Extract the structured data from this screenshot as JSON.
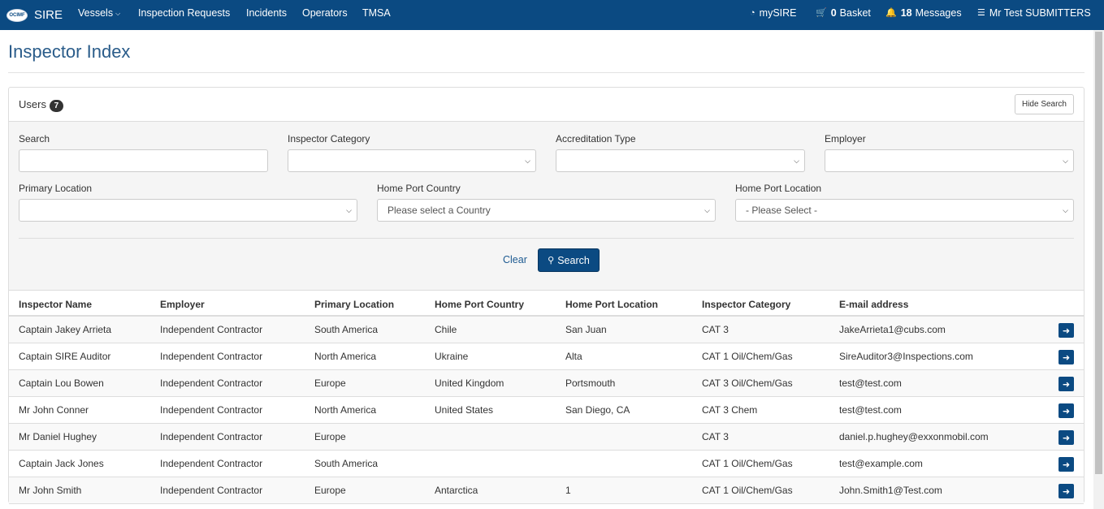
{
  "nav": {
    "logo_text": "OCIMF",
    "brand": "SIRE",
    "items": [
      {
        "label": "Vessels",
        "dropdown": true
      },
      {
        "label": "Inspection Requests"
      },
      {
        "label": "Incidents"
      },
      {
        "label": "Operators"
      },
      {
        "label": "TMSA"
      }
    ],
    "right": {
      "mysire": "mySIRE",
      "basket_count": "0",
      "basket_label": "Basket",
      "messages_count": "18",
      "messages_label": "Messages",
      "user": "Mr Test SUBMITTERS"
    },
    "color": "#0b4a82"
  },
  "page": {
    "title": "Inspector Index"
  },
  "panel": {
    "title": "Users",
    "count": "7",
    "hide_search_label": "Hide Search"
  },
  "filters": {
    "search": {
      "label": "Search",
      "value": ""
    },
    "inspector_category": {
      "label": "Inspector Category",
      "value": ""
    },
    "accreditation_type": {
      "label": "Accreditation Type",
      "value": ""
    },
    "employer": {
      "label": "Employer",
      "value": ""
    },
    "primary_location": {
      "label": "Primary Location",
      "value": ""
    },
    "home_port_country": {
      "label": "Home Port Country",
      "value": "Please select a Country"
    },
    "home_port_location": {
      "label": "Home Port Location",
      "value": "- Please Select -"
    },
    "clear_label": "Clear",
    "search_label": "Search"
  },
  "table": {
    "columns": [
      "Inspector Name",
      "Employer",
      "Primary Location",
      "Home Port Country",
      "Home Port Location",
      "Inspector Category",
      "E-mail address"
    ],
    "rows": [
      [
        "Captain Jakey Arrieta",
        "Independent Contractor",
        "South America",
        "Chile",
        "San Juan",
        "CAT 3",
        "JakeArrieta1@cubs.com"
      ],
      [
        "Captain SIRE Auditor",
        "Independent Contractor",
        "North America",
        "Ukraine",
        "Alta",
        "CAT 1 Oil/Chem/Gas",
        "SireAuditor3@Inspections.com"
      ],
      [
        "Captain Lou Bowen",
        "Independent Contractor",
        "Europe",
        "United Kingdom",
        "Portsmouth",
        "CAT 3 Oil/Chem/Gas",
        "test@test.com"
      ],
      [
        "Mr John Conner",
        "Independent Contractor",
        "North America",
        "United States",
        "San Diego, CA",
        "CAT 3 Chem",
        "test@test.com"
      ],
      [
        "Mr Daniel Hughey",
        "Independent Contractor",
        "Europe",
        "",
        "",
        "CAT 3",
        "daniel.p.hughey@exxonmobil.com"
      ],
      [
        "Captain Jack Jones",
        "Independent Contractor",
        "South America",
        "",
        "",
        "CAT 1 Oil/Chem/Gas",
        "test@example.com"
      ],
      [
        "Mr John Smith",
        "Independent Contractor",
        "Europe",
        "Antarctica",
        "1",
        "CAT 1 Oil/Chem/Gas",
        "John.Smith1@Test.com"
      ]
    ]
  }
}
